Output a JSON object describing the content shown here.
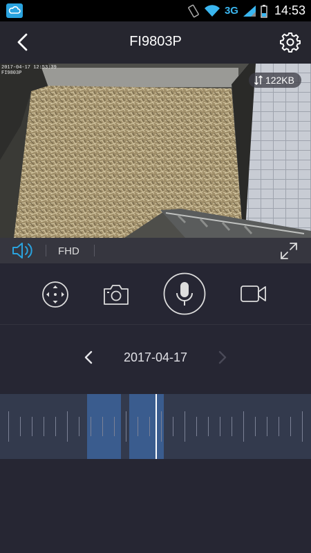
{
  "status_bar": {
    "network": "3G",
    "time": "14:53"
  },
  "header": {
    "title": "FI9803P"
  },
  "video": {
    "osd_timestamp": "2017-04-17 12:53:39",
    "osd_name": "FI9803P",
    "bitrate": "122KB"
  },
  "controls": {
    "quality": "FHD"
  },
  "playback": {
    "date": "2017-04-17"
  },
  "timeline": {
    "recorded_segments_fraction": [
      [
        0.28,
        0.39
      ],
      [
        0.415,
        0.525
      ]
    ],
    "playhead_fraction": 0.5
  },
  "colors": {
    "accent": "#2aa3df",
    "background": "#262633",
    "segment": "#3a5c8e"
  }
}
